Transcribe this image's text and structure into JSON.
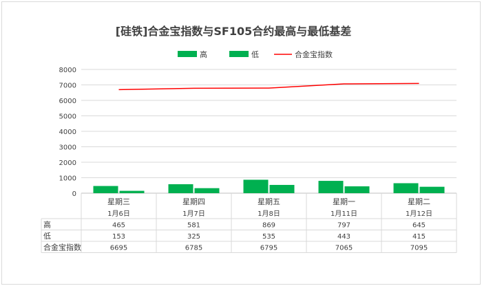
{
  "chart_data": {
    "type": "bar",
    "title": "[硅铁]合金宝指数与SF105合约最高与最低基差",
    "categories": [
      {
        "weekday": "星期三",
        "date": "1月6日"
      },
      {
        "weekday": "星期四",
        "date": "1月7日"
      },
      {
        "weekday": "星期五",
        "date": "1月8日"
      },
      {
        "weekday": "星期一",
        "date": "1月11日"
      },
      {
        "weekday": "星期二",
        "date": "1月12日"
      }
    ],
    "series": [
      {
        "name": "高",
        "type": "bar",
        "color": "#00b050",
        "values": [
          465,
          581,
          869,
          797,
          645
        ]
      },
      {
        "name": "低",
        "type": "bar",
        "color": "#00b050",
        "values": [
          153,
          325,
          535,
          443,
          415
        ]
      },
      {
        "name": "合金宝指数",
        "type": "line",
        "color": "#ff0000",
        "values": [
          6695,
          6785,
          6795,
          7065,
          7095
        ]
      }
    ],
    "ylim": [
      0,
      8000
    ],
    "yticks": [
      0,
      1000,
      2000,
      3000,
      4000,
      5000,
      6000,
      7000,
      8000
    ],
    "grid": true,
    "legend": "top",
    "data_table": true
  }
}
